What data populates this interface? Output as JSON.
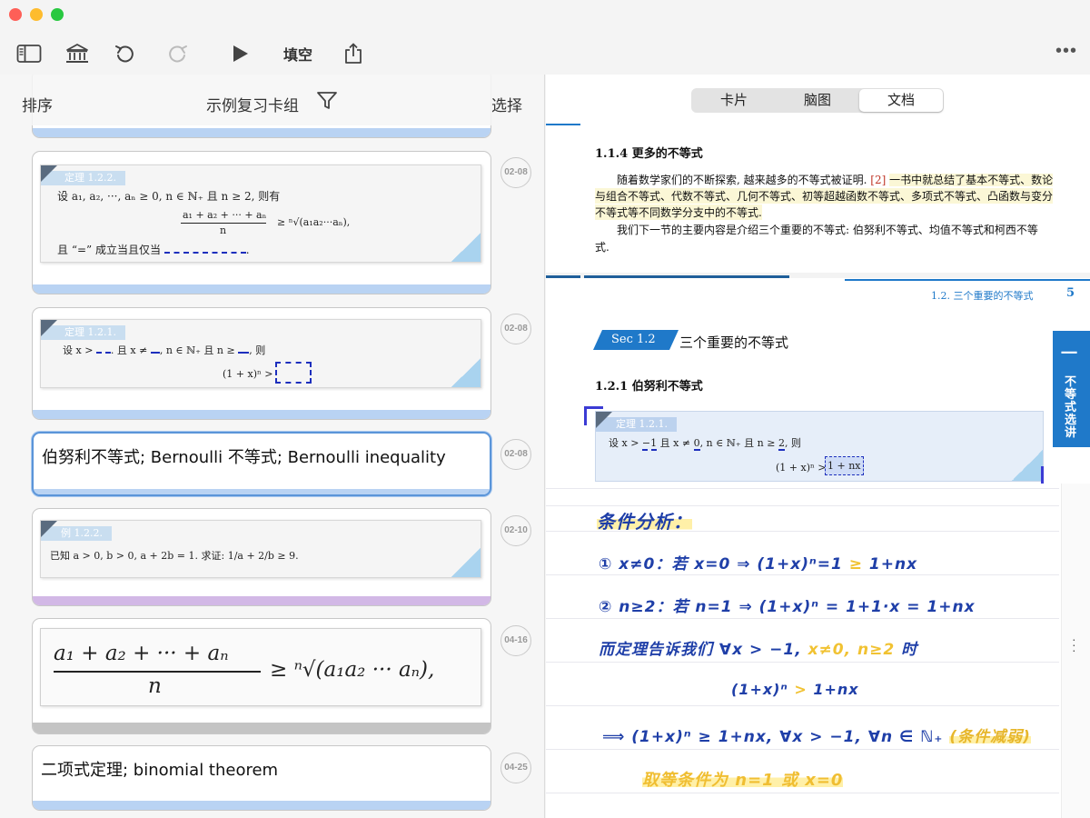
{
  "toolbar": {
    "fill_label": "填空",
    "more_label": "•••"
  },
  "left": {
    "sort_label": "排序",
    "title": "示例复习卡组",
    "select_label": "选择",
    "cards": [
      {
        "date": "02-08",
        "tag": "定理 1.2.2.",
        "line1": "设 a₁, a₂, ···, aₙ ≥ 0, n ∈ ℕ₊ 且 n ≥ 2, 则有",
        "numerator": "a₁ + a₂ + ··· + aₙ",
        "denominator": "n",
        "rhs": "≥ ⁿ√(a₁a₂···aₙ),",
        "line3": "且 “=” 成立当且仅当",
        "line3_tail": "."
      },
      {
        "date": "02-08",
        "tag": "定理 1.2.1.",
        "line1a": "设 x >",
        "line1b": "且 x ≠",
        "line1c": "n ∈ ℕ₊ 且 n ≥",
        "line1d": "则",
        "line2": "(1 + x)ⁿ >"
      },
      {
        "date": "02-08",
        "text": "伯努利不等式; Bernoulli 不等式; Bernoulli inequality"
      },
      {
        "date": "02-10",
        "tag": "例 1.2.2.",
        "line1": "已知 a > 0, b > 0, a + 2b = 1. 求证: 1/a + 2/b ≥ 9."
      },
      {
        "date": "04-16",
        "numerator": "a₁ + a₂ + ··· + aₙ",
        "denominator": "n",
        "rhs": "≥ ⁿ√(a₁a₂ ··· aₙ),"
      },
      {
        "date": "04-25",
        "text": "二项式定理; binomial theorem"
      }
    ]
  },
  "right": {
    "segments": [
      "卡片",
      "脑图",
      "文档"
    ],
    "active_segment": "文档",
    "section_1_1_4": "1.1.4   更多的不等式",
    "para1_a": "随着数学家们的不断探索, 越来越多的不等式被证明.",
    "para1_ref": "[2]",
    "para1_b": "一书中就总结了基本不等式、数论",
    "para1_line2": "与组合不等式、代数不等式、几何不等式、初等超越函数不等式、多项式不等式、凸函数与变分",
    "para1_line3": "不等式等不同数学分支中的不等式.",
    "para2_line1": "我们下一节的主要内容是介绍三个重要的不等式: 伯努利不等式、均值不等式和柯西不等",
    "para2_line2": "式.",
    "running_head": "1.2.  三个重要的不等式",
    "page_number": "5",
    "sec_badge": "Sec 1.2",
    "sec_title": "三个重要的不等式",
    "side_tab_number": "一",
    "side_tab_text": "不等式选讲",
    "subsection": "1.2.1   伯努利不等式",
    "doc_thm_tag": "定理 1.2.1.",
    "doc_thm_line1a": "设 x >",
    "doc_thm_blank1": "−1",
    "doc_thm_line1b": "且 x ≠",
    "doc_thm_blank2": "0",
    "doc_thm_line1c": ", n ∈ ℕ₊ 且 n ≥",
    "doc_thm_blank3": "2",
    "doc_thm_line1d": ", 则",
    "doc_thm_line2": "(1 + x)ⁿ >",
    "doc_thm_answer": "1 + nx",
    "notes": {
      "title": "条件分析：",
      "line1": "① x≠0：若 x=0 ⇒ (1+x)ⁿ=1",
      "line1_y": "≥",
      "line1_tail": "1+nx",
      "line2": "② n≥2：若 n=1 ⇒ (1+x)ⁿ = 1+1·x = 1+nx",
      "line3_a": "而定理告诉我们 ∀x > −1,",
      "line3_y": "x≠0, n≥2",
      "line3_b": "时",
      "line4_a": "(1+x)ⁿ",
      "line4_y": ">",
      "line4_b": "1+nx",
      "line5_a": "⟹ (1+x)ⁿ ≥ 1+nx, ∀x > −1, ∀n ∈ ℕ₊",
      "line5_y": "(条件减弱)",
      "line6": "取等条件为 n=1 或 x=0"
    }
  }
}
